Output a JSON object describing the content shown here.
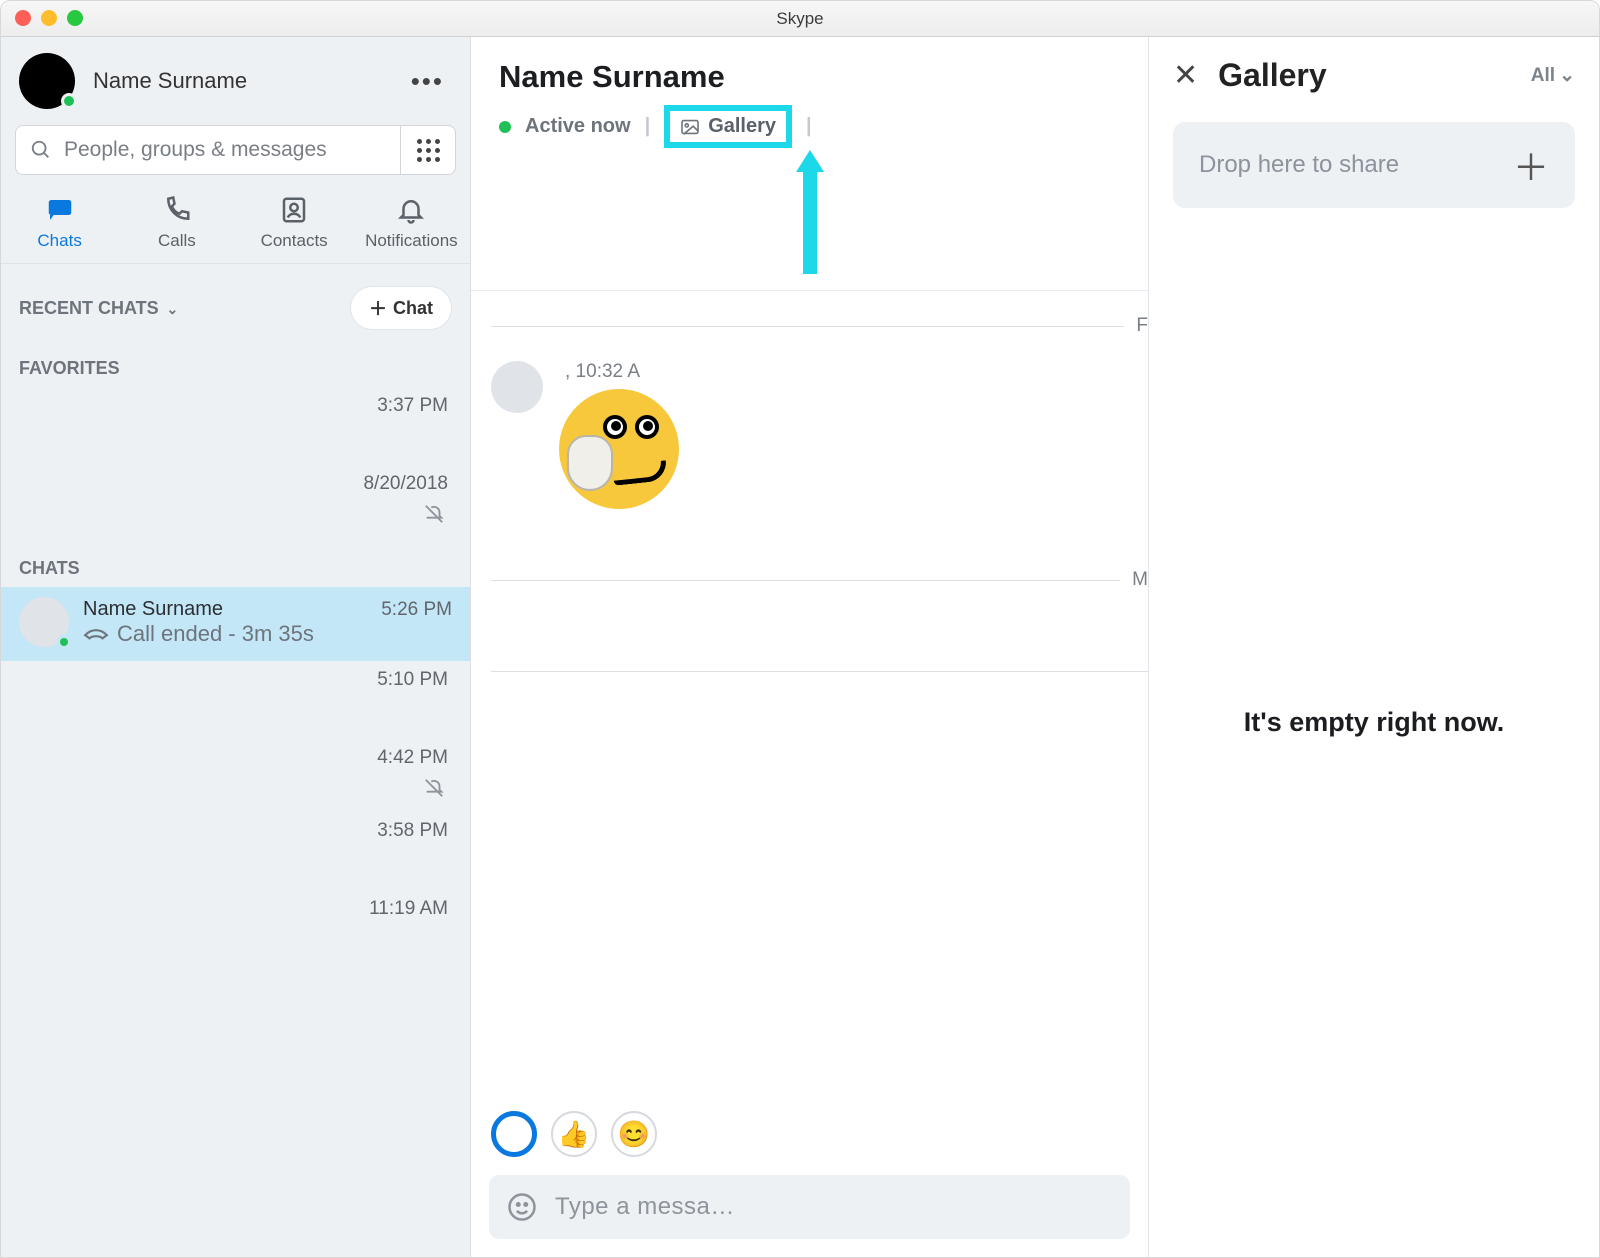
{
  "window": {
    "title": "Skype"
  },
  "me": {
    "display_name": "Name Surname"
  },
  "search": {
    "placeholder": "People, groups & messages"
  },
  "nav": {
    "chats": "Chats",
    "calls": "Calls",
    "contacts": "Contacts",
    "notifications": "Notifications",
    "active": "chats"
  },
  "sidebar": {
    "recent_label": "RECENT CHATS",
    "chat_button": "Chat",
    "favorites_label": "FAVORITES",
    "chats_label": "CHATS",
    "timeline": [
      {
        "time": "3:37 PM",
        "muted": false
      },
      {
        "time": "8/20/2018",
        "muted": true
      }
    ],
    "selected_chat": {
      "name": "Name Surname",
      "time": "5:26 PM",
      "subtitle": "Call ended - 3m 35s"
    },
    "below": [
      {
        "time": "5:10 PM",
        "muted": false
      },
      {
        "time": "4:42 PM",
        "muted": true
      },
      {
        "time": "3:58 PM",
        "muted": false
      },
      {
        "time": "11:19 AM",
        "muted": false
      }
    ]
  },
  "conversation": {
    "title": "Name Surname",
    "status": "Active now",
    "gallery_pill": "Gallery",
    "day_letter_1": "F",
    "day_letter_2": "M",
    "msg_time": ", 10:32 A",
    "compose_placeholder": "Type a messa…"
  },
  "gallery": {
    "title": "Gallery",
    "filter": "All",
    "drop_text": "Drop here to share",
    "empty_text": "It's empty right now."
  }
}
